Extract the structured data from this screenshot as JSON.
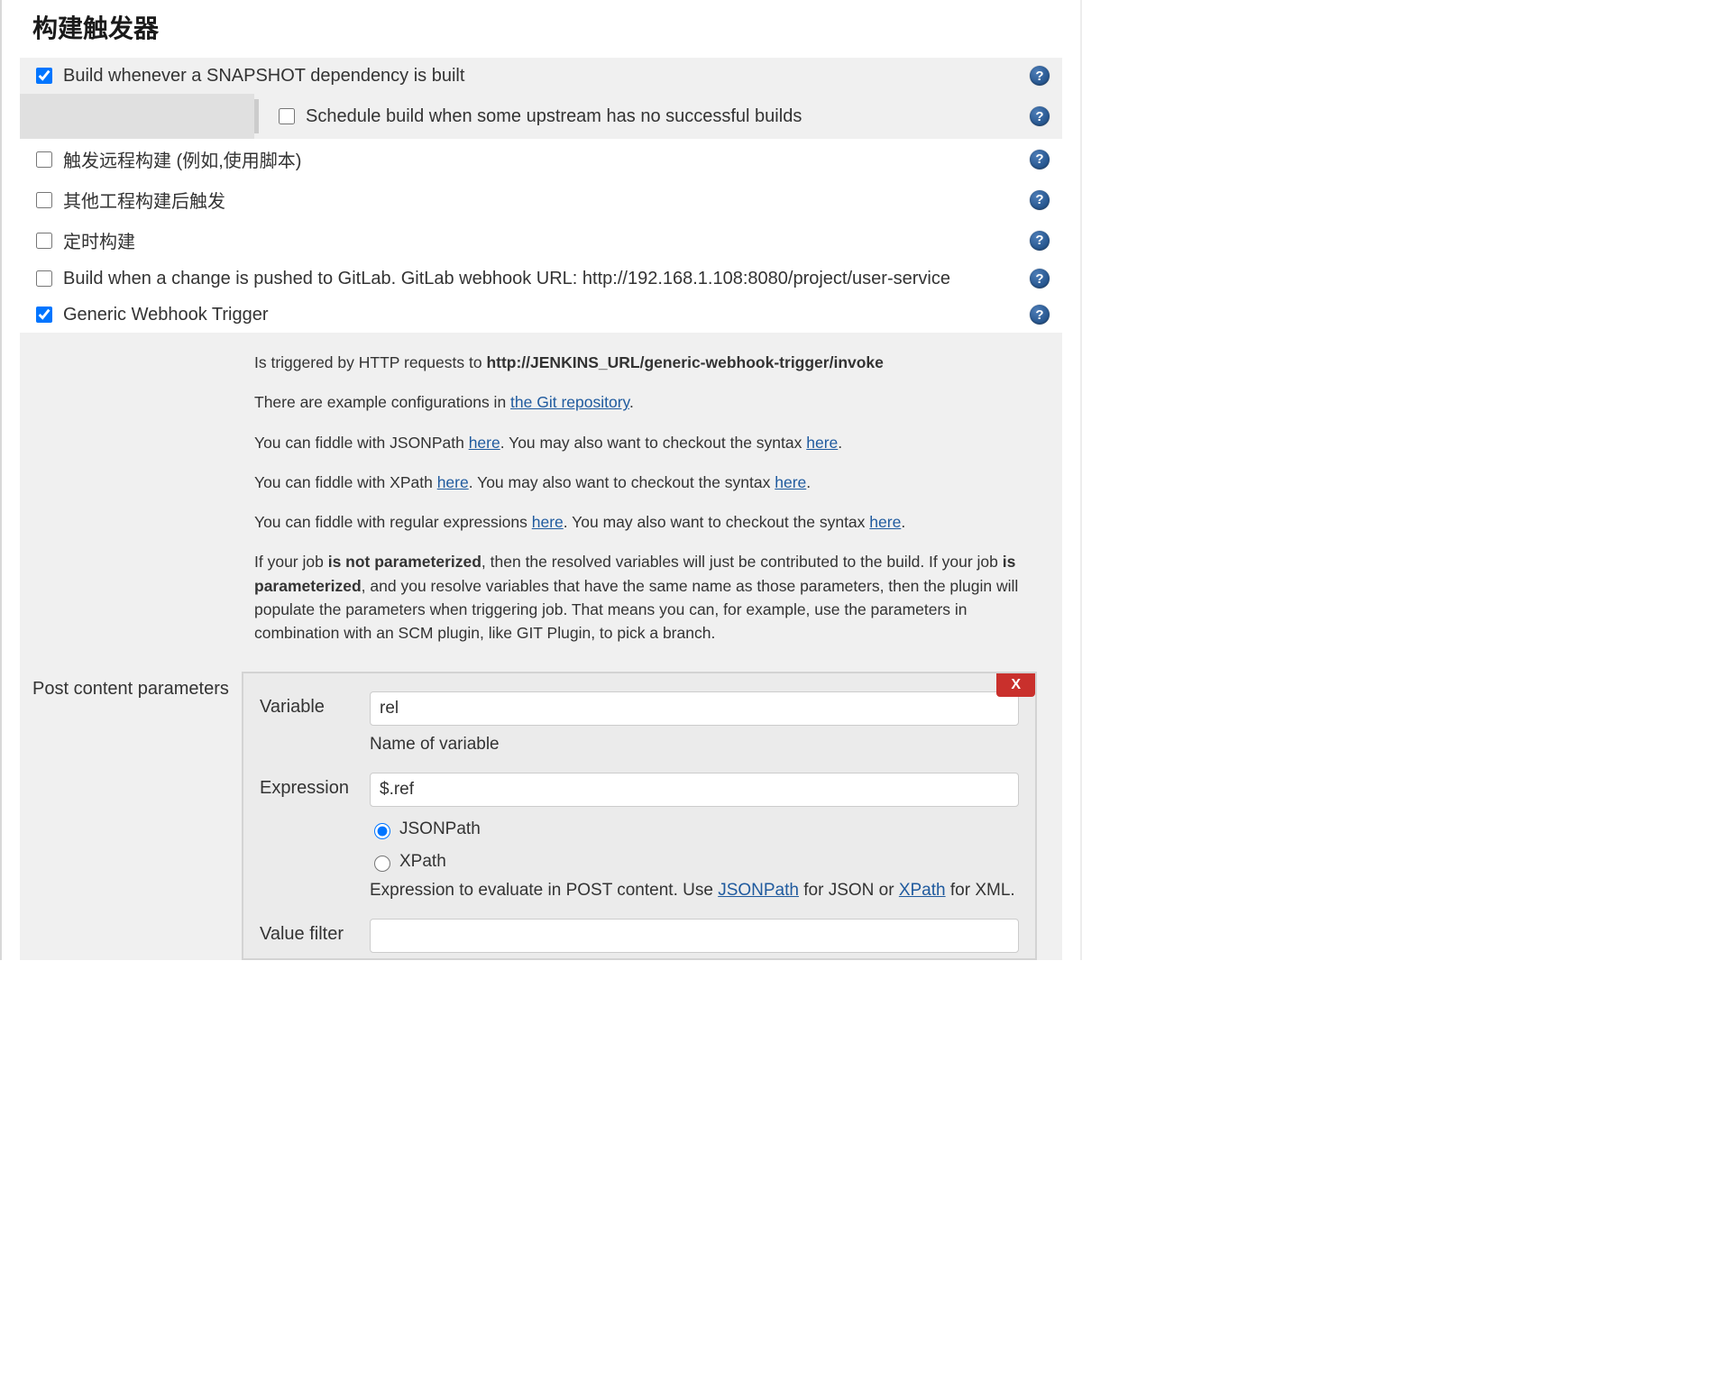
{
  "section_title": "构建触发器",
  "triggers": {
    "snapshot": {
      "label": "Build whenever a SNAPSHOT dependency is built",
      "checked": true
    },
    "schedule_upstream": {
      "label": "Schedule build when some upstream has no successful builds",
      "checked": false
    },
    "remote": {
      "label": "触发远程构建 (例如,使用脚本)",
      "checked": false
    },
    "after_other": {
      "label": "其他工程构建后触发",
      "checked": false
    },
    "timer": {
      "label": "定时构建",
      "checked": false
    },
    "gitlab": {
      "label": "Build when a change is pushed to GitLab. GitLab webhook URL: http://192.168.1.108:8080/project/user-service",
      "checked": false
    },
    "generic_webhook": {
      "label": "Generic Webhook Trigger",
      "checked": true
    }
  },
  "webhook_desc": {
    "line1_prefix": "Is triggered by HTTP requests to ",
    "line1_bold": "http://JENKINS_URL/generic-webhook-trigger/invoke",
    "line2_prefix": "There are example configurations in ",
    "line2_link": "the Git repository",
    "line3_prefix": "You can fiddle with JSONPath ",
    "line3_link1": "here",
    "line3_mid": ". You may also want to checkout the syntax ",
    "line3_link2": "here",
    "line4_prefix": "You can fiddle with XPath ",
    "line4_link1": "here",
    "line4_mid": ". You may also want to checkout the syntax ",
    "line4_link2": "here",
    "line5_prefix": "You can fiddle with regular expressions ",
    "line5_link1": "here",
    "line5_mid": ". You may also want to checkout the syntax ",
    "line5_link2": "here",
    "line6_p1": "If your job ",
    "line6_b1": "is not parameterized",
    "line6_p2": ", then the resolved variables will just be contributed to the build. If your job ",
    "line6_b2": "is parameterized",
    "line6_p3": ", and you resolve variables that have the same name as those parameters, then the plugin will populate the parameters when triggering job. That means you can, for example, use the parameters in combination with an SCM plugin, like GIT Plugin, to pick a branch."
  },
  "post_params": {
    "section_label": "Post content parameters",
    "delete_label": "X",
    "variable_label": "Variable",
    "variable_value": "rel",
    "variable_help": "Name of variable",
    "expression_label": "Expression",
    "expression_value": "$.ref",
    "radio_jsonpath": "JSONPath",
    "radio_xpath": "XPath",
    "expression_help_p1": "Expression to evaluate in POST content. Use ",
    "expression_help_link1": "JSONPath",
    "expression_help_p2": " for JSON or ",
    "expression_help_link2": "XPath",
    "expression_help_p3": " for XML.",
    "value_filter_label": "Value filter",
    "value_filter_value": ""
  }
}
